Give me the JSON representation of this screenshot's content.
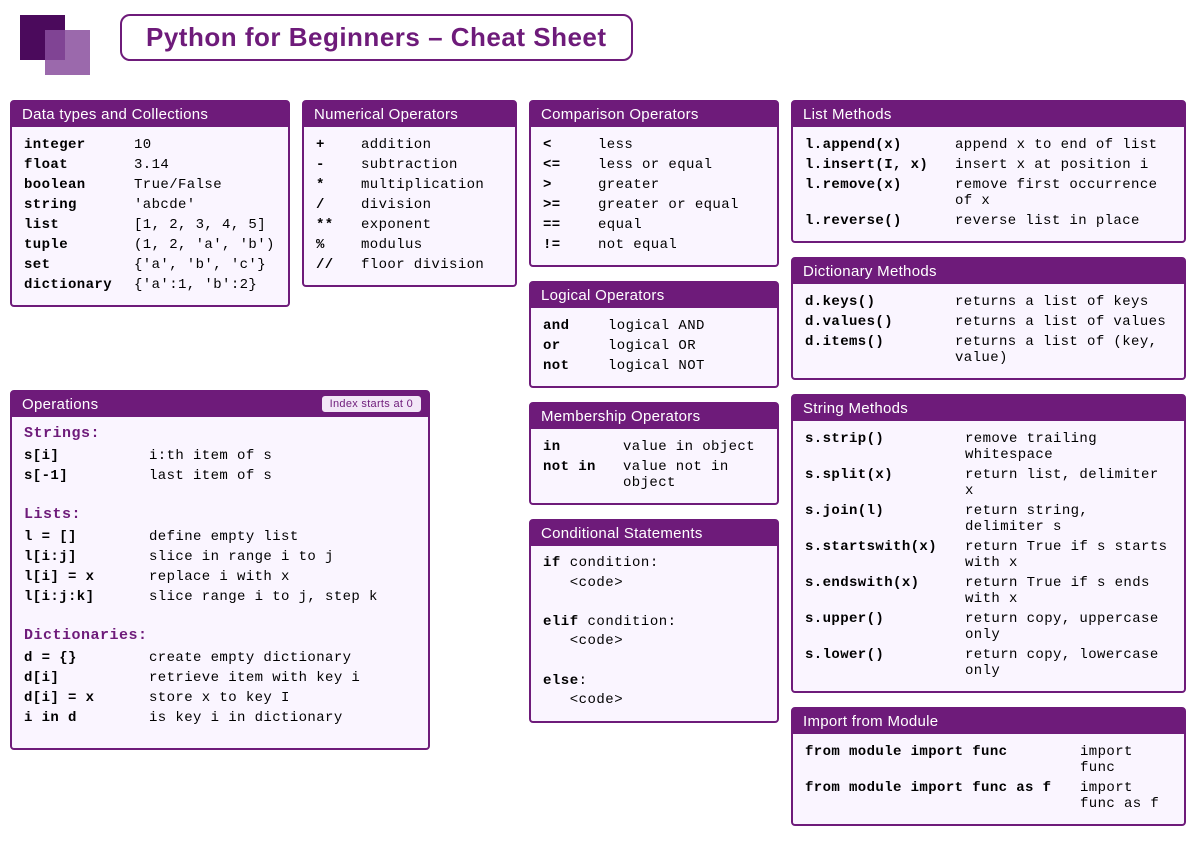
{
  "title": "Python for Beginners – Cheat Sheet",
  "cards": {
    "datatypes": {
      "header": "Data types and Collections",
      "rows": [
        {
          "k": "integer",
          "v": "10"
        },
        {
          "k": "float",
          "v": "3.14"
        },
        {
          "k": "boolean",
          "v": "True/False"
        },
        {
          "k": "string",
          "v": "'abcde'"
        },
        {
          "k": "list",
          "v": "[1, 2, 3, 4, 5]"
        },
        {
          "k": "tuple",
          "v": "(1, 2, 'a', 'b')"
        },
        {
          "k": "set",
          "v": "{'a', 'b', 'c'}"
        },
        {
          "k": "dictionary",
          "v": "{'a':1, 'b':2}"
        }
      ]
    },
    "numops": {
      "header": "Numerical Operators",
      "rows": [
        {
          "k": "+",
          "v": "addition"
        },
        {
          "k": "-",
          "v": "subtraction"
        },
        {
          "k": "*",
          "v": "multiplication"
        },
        {
          "k": "/",
          "v": "division"
        },
        {
          "k": "**",
          "v": "exponent"
        },
        {
          "k": "%",
          "v": "modulus"
        },
        {
          "k": "//",
          "v": "floor division"
        }
      ]
    },
    "cmpops": {
      "header": "Comparison Operators",
      "rows": [
        {
          "k": "<",
          "v": "less"
        },
        {
          "k": "<=",
          "v": "less or equal"
        },
        {
          "k": ">",
          "v": "greater"
        },
        {
          "k": ">=",
          "v": "greater or equal"
        },
        {
          "k": "==",
          "v": "equal"
        },
        {
          "k": "!=",
          "v": "not equal"
        }
      ]
    },
    "logops": {
      "header": "Logical Operators",
      "rows": [
        {
          "k": "and",
          "v": "logical AND"
        },
        {
          "k": "or",
          "v": "logical OR"
        },
        {
          "k": "not",
          "v": "logical NOT"
        }
      ]
    },
    "memops": {
      "header": "Membership Operators",
      "rows": [
        {
          "k": "in",
          "v": "value in object"
        },
        {
          "k": "not in",
          "v": "value not in object"
        }
      ]
    },
    "cond": {
      "header": "Conditional Statements",
      "lines": [
        {
          "b": "if",
          "t": " condition:"
        },
        {
          "b": "",
          "t": "   <code>"
        },
        {
          "b": "",
          "t": ""
        },
        {
          "b": "elif",
          "t": " condition:"
        },
        {
          "b": "",
          "t": "   <code>"
        },
        {
          "b": "",
          "t": ""
        },
        {
          "b": "else",
          "t": ":"
        },
        {
          "b": "",
          "t": "   <code>"
        }
      ]
    },
    "listmethods": {
      "header": "List Methods",
      "rows": [
        {
          "k": "l.append(x)",
          "v": "append x to end of list"
        },
        {
          "k": "l.insert(I, x)",
          "v": "insert x at position i"
        },
        {
          "k": "l.remove(x)",
          "v": "remove first occurrence of x"
        },
        {
          "k": "l.reverse()",
          "v": "reverse list in place"
        }
      ]
    },
    "dictmethods": {
      "header": "Dictionary Methods",
      "rows": [
        {
          "k": "d.keys()",
          "v": "returns a list of keys"
        },
        {
          "k": "d.values()",
          "v": "returns a list of values"
        },
        {
          "k": "d.items()",
          "v": "returns a list of (key, value)"
        }
      ]
    },
    "strmethods": {
      "header": "String Methods",
      "rows": [
        {
          "k": "s.strip()",
          "v": "remove trailing whitespace"
        },
        {
          "k": "s.split(x)",
          "v": "return list, delimiter x"
        },
        {
          "k": "s.join(l)",
          "v": "return string, delimiter s"
        },
        {
          "k": "s.startswith(x)",
          "v": "return True if s starts with x"
        },
        {
          "k": "s.endswith(x)",
          "v": "return True if s ends with x"
        },
        {
          "k": "s.upper()",
          "v": "return copy, uppercase only"
        },
        {
          "k": "s.lower()",
          "v": "return copy, lowercase only"
        }
      ]
    },
    "import": {
      "header": "Import from Module",
      "rows": [
        {
          "k": "from module import func",
          "v": "import func"
        },
        {
          "k": "from module import func as f",
          "v": "import func as f"
        }
      ]
    },
    "operations": {
      "header": "Operations",
      "badge": "Index starts at 0",
      "sections": [
        {
          "title": "Strings:",
          "rows": [
            {
              "k": "s[i]",
              "v": "i:th item of s"
            },
            {
              "k": "s[-1]",
              "v": "last item of s"
            }
          ]
        },
        {
          "title": "Lists:",
          "rows": [
            {
              "k": "l = []",
              "v": "define empty list"
            },
            {
              "k": "l[i:j]",
              "v": "slice in range i to j"
            },
            {
              "k": "l[i] = x",
              "v": "replace i with x"
            },
            {
              "k": "l[i:j:k]",
              "v": "slice range i to j, step k"
            }
          ]
        },
        {
          "title": "Dictionaries:",
          "rows": [
            {
              "k": "d = {}",
              "v": "create empty dictionary"
            },
            {
              "k": "d[i]",
              "v": "retrieve item with key i"
            },
            {
              "k": "d[i] = x",
              "v": "store x to key I"
            },
            {
              "k": "i in d",
              "v": "is key i in dictionary"
            }
          ]
        }
      ]
    }
  }
}
